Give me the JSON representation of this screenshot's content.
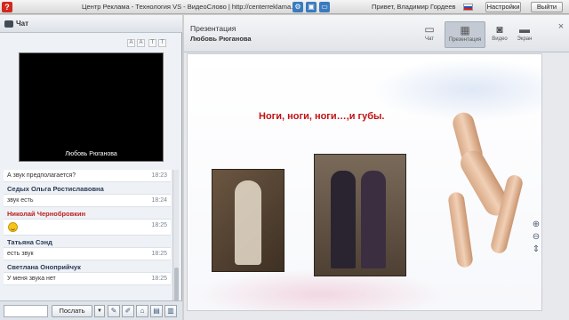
{
  "topbar": {
    "help_label": "?",
    "title": "Центр Реклама - Технология VS - ВидеоСлово | http://centerreklama.ru",
    "icons": [
      "gear-icon",
      "image-icon",
      "window-icon"
    ],
    "greeting": "Привет, Владимир Гордеев",
    "flag": "russian-flag-icon",
    "settings_label": "Настройки",
    "logout_label": "Выйти"
  },
  "chat": {
    "title": "Чат",
    "controls": [
      "A",
      "A",
      "T",
      "T"
    ],
    "video_caption": "Любовь Рюганова",
    "messages": [
      {
        "kind": "text",
        "text": "А звук предполагается?",
        "time": "18:23"
      },
      {
        "kind": "name",
        "name": "Седых Ольга Ростиславовна",
        "color": "#2a3a55"
      },
      {
        "kind": "text",
        "text": "звук есть",
        "time": "18:24"
      },
      {
        "kind": "name",
        "name": "Николай Чернобровкин",
        "color": "#c02020"
      },
      {
        "kind": "smile",
        "icon": "smiley-icon",
        "time": "18:25"
      },
      {
        "kind": "name",
        "name": "Татьяна Сэнд",
        "color": "#2a3a55"
      },
      {
        "kind": "text",
        "text": "есть звук",
        "time": "18:25"
      },
      {
        "kind": "name",
        "name": "Светлана Оноприйчук",
        "color": "#2a3a55"
      },
      {
        "kind": "text",
        "text": "У меня звука нет",
        "time": "18:25"
      }
    ],
    "input_placeholder": "",
    "send_label": "Послать",
    "send_arrow": "▼"
  },
  "presentation": {
    "title": "Презентация",
    "presenter": "Любовь Рюганова",
    "modes": [
      {
        "label": "Чат",
        "icon": "chat-icon",
        "active": false
      },
      {
        "label": "Презентация",
        "icon": "presentation-icon",
        "active": true
      },
      {
        "label": "Видео",
        "icon": "video-camera-icon",
        "active": false
      },
      {
        "label": "Экран",
        "icon": "monitor-icon",
        "active": false
      }
    ],
    "close_label": "×",
    "slide_title": "Ноги, ноги, ноги…,и губы.",
    "zoom_tools": [
      "zoom-in-icon",
      "zoom-out-icon",
      "fit-icon"
    ]
  },
  "colors": {
    "accent": "#3a7bbf",
    "slide_title": "#c01212",
    "help_button": "#d2281e"
  }
}
